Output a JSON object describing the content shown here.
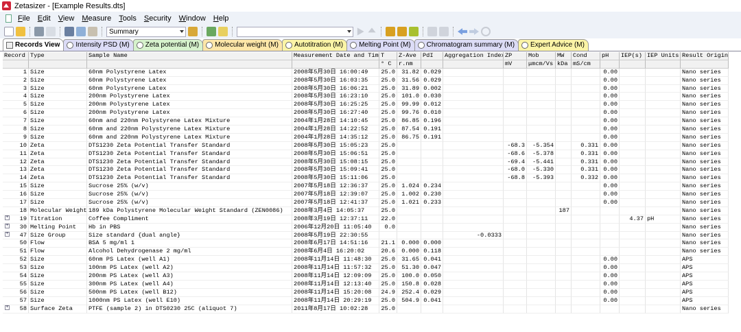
{
  "window": {
    "title": "Zetasizer - [Example Results.dts]"
  },
  "menu": [
    "File",
    "Edit",
    "View",
    "Measure",
    "Tools",
    "Security",
    "Window",
    "Help"
  ],
  "toolbar": {
    "view_combo": "Summary",
    "second_combo": ""
  },
  "tabs": [
    {
      "label": "Records View",
      "color": "#ffffff"
    },
    {
      "label": "Intensity PSD (M)",
      "color": "#dcdcf6"
    },
    {
      "label": "Zeta potential (M)",
      "color": "#d6f2cc"
    },
    {
      "label": "Molecular weight (M)",
      "color": "#fde6a8"
    },
    {
      "label": "Autotitration (M)",
      "color": "#fbf4a6"
    },
    {
      "label": "Melting Point (M)",
      "color": "#dcdcf6"
    },
    {
      "label": "Chromatogram summary (M)",
      "color": "#dcdcf6"
    },
    {
      "label": "Expert Advice (M)",
      "color": "#fbf4a6"
    }
  ],
  "table": {
    "headers": [
      "Record",
      "Type",
      "Sample Name",
      "Measurement Date and Time",
      "T",
      "Z-Ave",
      "PdI",
      "Aggregation Index",
      "ZP",
      "Mob",
      "MW",
      "Cond",
      "pH",
      "IEP(s)",
      "IEP Units",
      "Result Origin"
    ],
    "units": [
      "",
      "",
      "",
      "",
      "° C",
      "r.nm",
      "",
      "",
      "mV",
      "μmcm/Vs",
      "kDa",
      "mS/cm",
      "",
      "",
      "",
      ""
    ],
    "rows": [
      [
        "1",
        "Size",
        "60nm Polystyrene Latex",
        "2008年5月30日 16:00:49",
        "25.0",
        "31.82",
        "0.029",
        "",
        "",
        "",
        "",
        "",
        "0.00",
        "",
        "",
        "Nano series"
      ],
      [
        "2",
        "Size",
        "60nm Polystyrene Latex",
        "2008年5月30日 16:03:35",
        "25.0",
        "31.56",
        "0.029",
        "",
        "",
        "",
        "",
        "",
        "0.00",
        "",
        "",
        "Nano series"
      ],
      [
        "3",
        "Size",
        "60nm Polystyrene Latex",
        "2008年5月30日 16:06:21",
        "25.0",
        "31.89",
        "0.002",
        "",
        "",
        "",
        "",
        "",
        "0.00",
        "",
        "",
        "Nano series"
      ],
      [
        "4",
        "Size",
        "200nm Polystyrene Latex",
        "2008年5月30日 16:23:10",
        "25.0",
        "101.0",
        "0.030",
        "",
        "",
        "",
        "",
        "",
        "0.00",
        "",
        "",
        "Nano series"
      ],
      [
        "5",
        "Size",
        "200nm Polystyrene Latex",
        "2008年5月30日 16:25:25",
        "25.0",
        "99.99",
        "0.012",
        "",
        "",
        "",
        "",
        "",
        "0.00",
        "",
        "",
        "Nano series"
      ],
      [
        "6",
        "Size",
        "200nm Polystyrene Latex",
        "2008年5月30日 16:27:40",
        "25.0",
        "99.76",
        "0.010",
        "",
        "",
        "",
        "",
        "",
        "0.00",
        "",
        "",
        "Nano series"
      ],
      [
        "7",
        "Size",
        "60nm and 220nm Polystyrene Latex Mixture",
        "2004年1月28日 14:10:45",
        "25.0",
        "86.85",
        "0.196",
        "",
        "",
        "",
        "",
        "",
        "0.00",
        "",
        "",
        "Nano series"
      ],
      [
        "8",
        "Size",
        "60nm and 220nm Polystyrene Latex Mixture",
        "2004年1月28日 14:22:52",
        "25.0",
        "87.54",
        "0.191",
        "",
        "",
        "",
        "",
        "",
        "0.00",
        "",
        "",
        "Nano series"
      ],
      [
        "9",
        "Size",
        "60nm and 220nm Polystyrene Latex Mixture",
        "2004年1月28日 14:35:12",
        "25.0",
        "86.75",
        "0.191",
        "",
        "",
        "",
        "",
        "",
        "0.00",
        "",
        "",
        "Nano series"
      ],
      [
        "10",
        "Zeta",
        "DTS1230 Zeta Potential Transfer Standard",
        "2008年5月30日 15:05:23",
        "25.0",
        "",
        "",
        "",
        "-68.3",
        "-5.354",
        "",
        "0.331",
        "0.00",
        "",
        "",
        "Nano series"
      ],
      [
        "11",
        "Zeta",
        "DTS1230 Zeta Potential Transfer Standard",
        "2008年5月30日 15:06:51",
        "25.0",
        "",
        "",
        "",
        "-68.6",
        "-5.378",
        "",
        "0.331",
        "0.00",
        "",
        "",
        "Nano series"
      ],
      [
        "12",
        "Zeta",
        "DTS1230 Zeta Potential Transfer Standard",
        "2008年5月30日 15:08:15",
        "25.0",
        "",
        "",
        "",
        "-69.4",
        "-5.441",
        "",
        "0.331",
        "0.00",
        "",
        "",
        "Nano series"
      ],
      [
        "13",
        "Zeta",
        "DTS1230 Zeta Potential Transfer Standard",
        "2008年5月30日 15:09:41",
        "25.0",
        "",
        "",
        "",
        "-68.0",
        "-5.330",
        "",
        "0.331",
        "0.00",
        "",
        "",
        "Nano series"
      ],
      [
        "14",
        "Zeta",
        "DTS1230 Zeta Potential Transfer Standard",
        "2008年5月30日 15:11:06",
        "25.0",
        "",
        "",
        "",
        "-68.8",
        "-5.393",
        "",
        "0.332",
        "0.00",
        "",
        "",
        "Nano series"
      ],
      [
        "15",
        "Size",
        "Sucrose 25% (w/v)",
        "2007年5月18日 12:36:37",
        "25.0",
        "1.024",
        "0.234",
        "",
        "",
        "",
        "",
        "",
        "0.00",
        "",
        "",
        "Nano series"
      ],
      [
        "16",
        "Size",
        "Sucrose 25% (w/v)",
        "2007年5月18日 12:39:07",
        "25.0",
        "1.002",
        "0.230",
        "",
        "",
        "",
        "",
        "",
        "0.00",
        "",
        "",
        "Nano series"
      ],
      [
        "17",
        "Size",
        "Sucrose 25% (w/v)",
        "2007年5月18日 12:41:37",
        "25.0",
        "1.021",
        "0.233",
        "",
        "",
        "",
        "",
        "",
        "0.00",
        "",
        "",
        "Nano series"
      ],
      [
        "18",
        "Molecular Weight",
        "189 kDa Polystyrene Molecular Weight Standard (ZEN0086)",
        "2008年3月4日 14:05:37",
        "25.0",
        "",
        "",
        "",
        "",
        "",
        "187",
        "",
        "",
        "",
        "",
        "Nano series"
      ],
      [
        "19",
        "Titration",
        "Coffee Compliment",
        "2008年3月19日 12:37:11",
        "22.0",
        "",
        "",
        "",
        "",
        "",
        "",
        "",
        "",
        "4.37",
        "pH",
        "Nano series"
      ],
      [
        "30",
        "Melting Point",
        "Hb in PBS",
        "2006年12月20日 11:05:40",
        "0.0",
        "",
        "",
        "",
        "",
        "",
        "",
        "",
        "",
        "",
        "",
        "Nano series"
      ],
      [
        "47",
        "Size Group",
        "Size standard {dual angle}",
        "2008年5月19日 22:30:55",
        "",
        "",
        "",
        "-0.0333",
        "",
        "",
        "",
        "",
        "",
        "",
        "",
        "Nano series"
      ],
      [
        "50",
        "Flow",
        "BSA 5 mg/ml 1",
        "2008年6月17日 14:51:16",
        "21.1",
        "0.000",
        "0.000",
        "",
        "",
        "",
        "",
        "",
        "",
        "",
        "",
        "Nano series"
      ],
      [
        "51",
        "Flow",
        "Alcohol Dehydrogenase 2 mg/ml",
        "2008年6月4日 16:20:02",
        "20.6",
        "0.000",
        "0.118",
        "",
        "",
        "",
        "",
        "",
        "",
        "",
        "",
        "Nano series"
      ],
      [
        "52",
        "Size",
        "60nm PS Latex (well A1)",
        "2008年11月14日 11:48:30",
        "25.0",
        "31.65",
        "0.041",
        "",
        "",
        "",
        "",
        "",
        "0.00",
        "",
        "",
        "APS"
      ],
      [
        "53",
        "Size",
        "100nm PS Latex (well A2)",
        "2008年11月14日 11:57:32",
        "25.0",
        "51.30",
        "0.047",
        "",
        "",
        "",
        "",
        "",
        "0.00",
        "",
        "",
        "APS"
      ],
      [
        "54",
        "Size",
        "200nm PS Latex (well A3)",
        "2008年11月14日 12:09:09",
        "25.0",
        "100.0",
        "0.050",
        "",
        "",
        "",
        "",
        "",
        "0.00",
        "",
        "",
        "APS"
      ],
      [
        "55",
        "Size",
        "300nm PS Latex (well A4)",
        "2008年11月14日 12:13:40",
        "25.0",
        "150.8",
        "0.028",
        "",
        "",
        "",
        "",
        "",
        "0.00",
        "",
        "",
        "APS"
      ],
      [
        "56",
        "Size",
        "500nm PS Latex (well B12)",
        "2008年11月14日 15:20:08",
        "24.9",
        "252.4",
        "0.029",
        "",
        "",
        "",
        "",
        "",
        "0.00",
        "",
        "",
        "APS"
      ],
      [
        "57",
        "Size",
        "1000nm PS Latex (well E10)",
        "2008年11月14日 20:29:19",
        "25.0",
        "504.9",
        "0.041",
        "",
        "",
        "",
        "",
        "",
        "0.00",
        "",
        "",
        "APS"
      ],
      [
        "58",
        "Surface Zeta",
        "PTFE (sample 2)  in DTS0230 25C (aliquot 7)",
        "2011年8月17日 10:02:28",
        "25.0",
        "",
        "",
        "",
        "",
        "",
        "",
        "",
        "",
        "",
        "",
        "Nano series"
      ]
    ],
    "expandable_records": [
      "19",
      "30",
      "47",
      "58"
    ]
  }
}
